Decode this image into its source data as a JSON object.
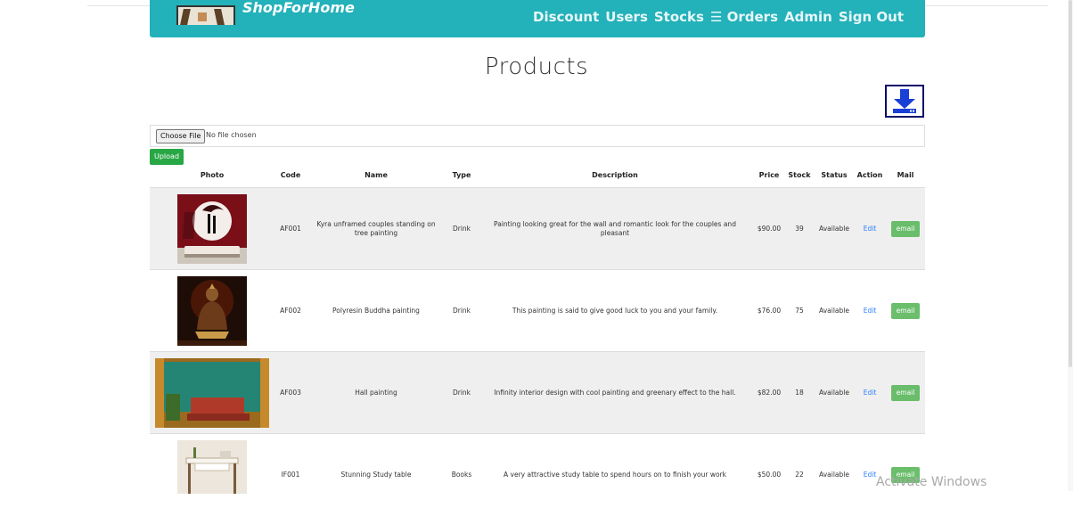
{
  "nav": {
    "brand": "ShopForHome",
    "links": [
      "Discount",
      "Users",
      "Stocks",
      "☰ Orders",
      "Admin",
      "Sign Out"
    ]
  },
  "page": {
    "title": "Products",
    "download_icon": "download-icon"
  },
  "upload": {
    "choose_label": "Choose File",
    "no_file": "No file chosen",
    "upload_label": "Upload"
  },
  "table": {
    "headers": [
      "Photo",
      "Code",
      "Name",
      "Type",
      "Description",
      "Price",
      "Stock",
      "Status",
      "Action",
      "Mail"
    ],
    "rows": [
      {
        "code": "AF001",
        "name": "Kyra unframed couples standing on tree painting",
        "type": "Drink",
        "description": "Painting looking great for the wall and romantic look for the couples and pleasant",
        "price": "$90.00",
        "stock": "39",
        "status": "Available",
        "action": "Edit",
        "mail": "email"
      },
      {
        "code": "AF002",
        "name": "Polyresin Buddha painting",
        "type": "Drink",
        "description": "This painting is said to give good luck to you and your family.",
        "price": "$76.00",
        "stock": "75",
        "status": "Available",
        "action": "Edit",
        "mail": "email"
      },
      {
        "code": "AF003",
        "name": "Hall painting",
        "type": "Drink",
        "description": "Infinity interior design with cool painting and greenary effect to the hall.",
        "price": "$82.00",
        "stock": "18",
        "status": "Available",
        "action": "Edit",
        "mail": "email"
      },
      {
        "code": "IF001",
        "name": "Stunning Study table",
        "type": "Books",
        "description": "A very attractive study table to spend hours on to finish your work",
        "price": "$50.00",
        "stock": "22",
        "status": "Available",
        "action": "Edit",
        "mail": "email"
      }
    ]
  },
  "watermark": "Activate Windows",
  "colors": {
    "navbar": "#23b1ba",
    "upload": "#28a745",
    "email": "#5cb85c",
    "edit_link": "#2a7fff",
    "download_icon": "#1a3fd6"
  }
}
